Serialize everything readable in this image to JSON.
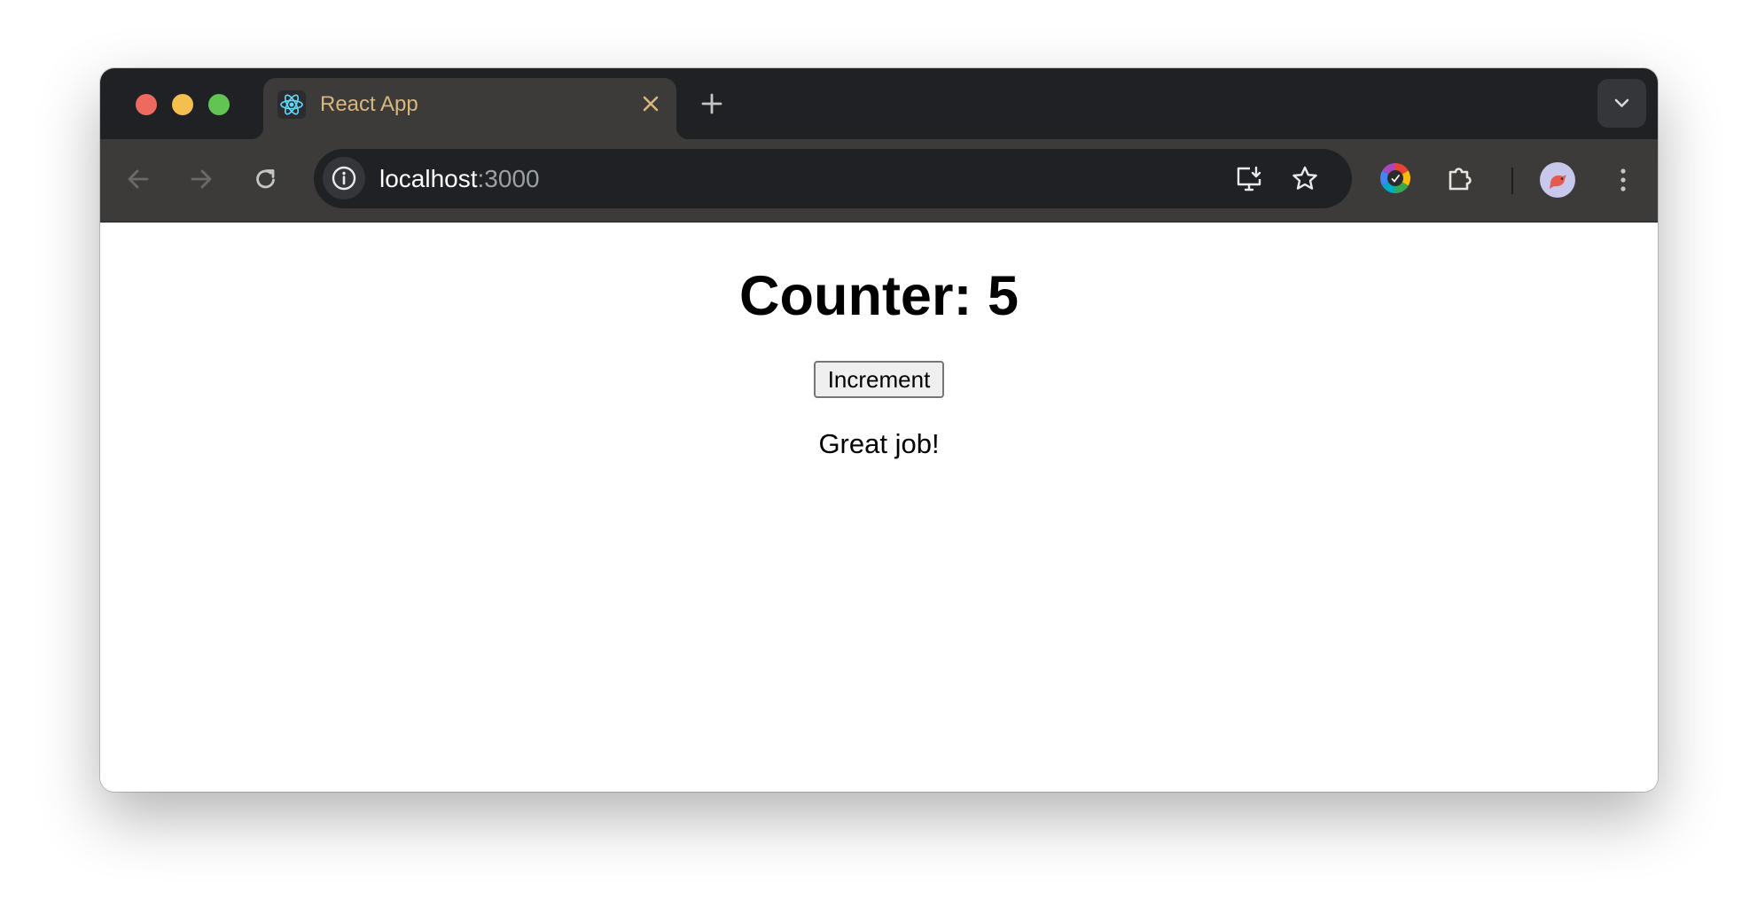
{
  "browser": {
    "tab": {
      "title": "React App",
      "favicon": "react-logo-icon"
    },
    "address_bar": {
      "host": "localhost",
      "port": ":3000"
    },
    "colors": {
      "tab_title": "#d8b77e",
      "close_light": "#ed6a5e",
      "minimize_light": "#f5bf4f",
      "maximize_light": "#61c554",
      "react_blue": "#61dafb"
    }
  },
  "app": {
    "title": "Counter: 5",
    "button_label": "Increment",
    "message": "Great job!"
  }
}
